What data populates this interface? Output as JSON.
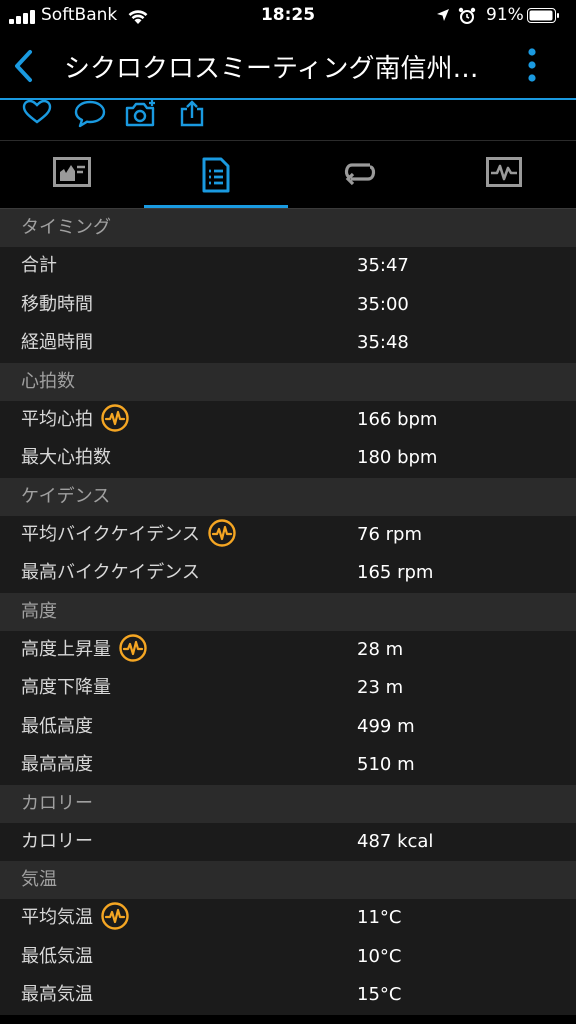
{
  "status_bar": {
    "carrier": "SoftBank",
    "time": "18:25",
    "battery": "91%"
  },
  "header": {
    "title": "シクロクロスミーティング南信州…",
    "accent_color": "#1a9ae0"
  },
  "icons": {
    "back": "chevron-left-icon",
    "more": "more-vertical-icon",
    "like": "heart-icon",
    "comment": "comment-icon",
    "photo": "camera-add-icon",
    "share": "share-icon",
    "hr_badge": "heart-rate-badge-icon"
  },
  "tabs": [
    {
      "name": "chart"
    },
    {
      "name": "stats",
      "active": true
    },
    {
      "name": "laps"
    },
    {
      "name": "graph"
    }
  ],
  "sections": [
    {
      "title": "タイミング",
      "rows": [
        {
          "label": "合計",
          "value": "35:47"
        },
        {
          "label": "移動時間",
          "value": "35:00"
        },
        {
          "label": "経過時間",
          "value": "35:48"
        }
      ]
    },
    {
      "title": "心拍数",
      "rows": [
        {
          "label": "平均心拍",
          "value": "166 bpm",
          "badge": true
        },
        {
          "label": "最大心拍数",
          "value": "180 bpm"
        }
      ]
    },
    {
      "title": "ケイデンス",
      "rows": [
        {
          "label": "平均バイクケイデンス",
          "value": "76 rpm",
          "badge": true
        },
        {
          "label": "最高バイクケイデンス",
          "value": "165 rpm"
        }
      ]
    },
    {
      "title": "高度",
      "rows": [
        {
          "label": "高度上昇量",
          "value": "28 m",
          "badge": true
        },
        {
          "label": "高度下降量",
          "value": "23 m"
        },
        {
          "label": "最低高度",
          "value": "499 m"
        },
        {
          "label": "最高高度",
          "value": "510 m"
        }
      ]
    },
    {
      "title": "カロリー",
      "rows": [
        {
          "label": "カロリー",
          "value": "487 kcal"
        }
      ]
    },
    {
      "title": "気温",
      "rows": [
        {
          "label": "平均気温",
          "value": "11°C",
          "badge": true
        },
        {
          "label": "最低気温",
          "value": "10°C"
        },
        {
          "label": "最高気温",
          "value": "15°C"
        }
      ]
    }
  ]
}
